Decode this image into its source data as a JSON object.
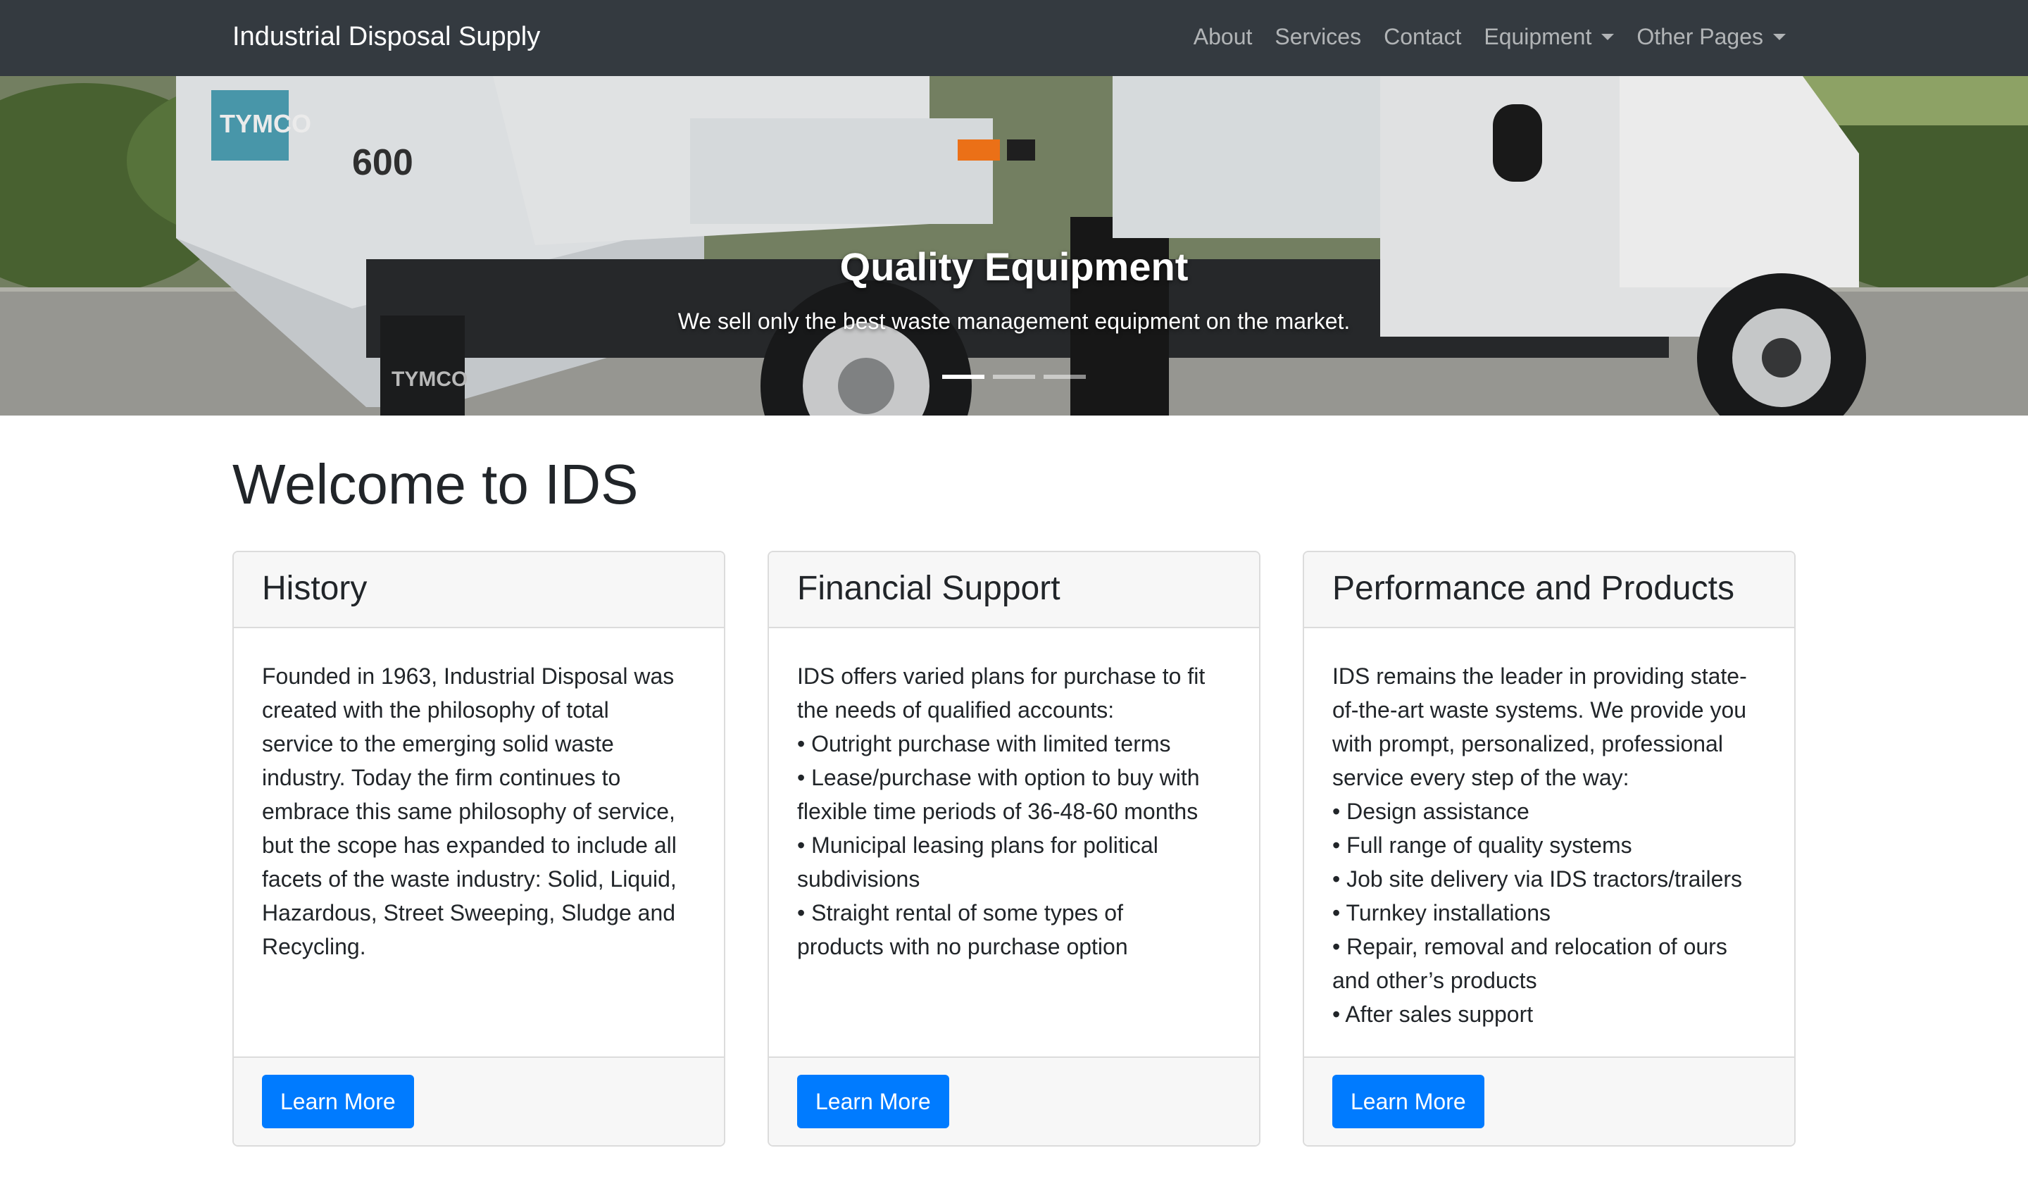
{
  "navbar": {
    "brand": "Industrial Disposal Supply",
    "links": [
      {
        "label": "About",
        "dropdown": false
      },
      {
        "label": "Services",
        "dropdown": false
      },
      {
        "label": "Contact",
        "dropdown": false
      },
      {
        "label": "Equipment",
        "dropdown": true
      },
      {
        "label": "Other Pages",
        "dropdown": true
      }
    ]
  },
  "hero": {
    "title": "Quality Equipment",
    "text": "We sell only the best waste management equipment on the market.",
    "slide_count": 3,
    "active_slide": 1,
    "truck_labels": [
      "TYMCO",
      "600",
      "TYMCO"
    ]
  },
  "main": {
    "title": "Welcome to IDS",
    "cards": [
      {
        "header": "History",
        "lines": [
          "Founded in 1963, Industrial Disposal was",
          "created with the philosophy of total",
          "service to the emerging solid waste",
          "industry. Today the firm continues to",
          "embrace this same philosophy of service,",
          "but the scope has expanded to include all",
          "facets of the waste industry: Solid, Liquid,",
          "Hazardous, Street Sweeping, Sludge and",
          "Recycling."
        ],
        "button": "Learn More"
      },
      {
        "header": "Financial Support",
        "lines": [
          "IDS offers varied plans for purchase to fit",
          "the needs of qualified accounts:",
          "• Outright purchase with limited terms",
          "• Lease/purchase with option to buy with",
          "flexible time periods of 36-48-60 months",
          "• Municipal leasing plans for political",
          "subdivisions",
          "• Straight rental of some types of",
          "products with no purchase option"
        ],
        "button": "Learn More"
      },
      {
        "header": "Performance and Products",
        "lines": [
          "IDS remains the leader in providing state-",
          "of-the-art waste systems. We provide you",
          "with prompt, personalized, professional",
          "service every step of the way:",
          "• Design assistance",
          "• Full range of quality systems",
          "• Job site delivery via IDS tractors/trailers",
          "• Turnkey installations",
          "• Repair, removal and relocation of ours",
          "and other’s products",
          "• After sales support"
        ],
        "button": "Learn More"
      }
    ]
  },
  "colors": {
    "navbar_bg": "#343a40",
    "primary": "#007bff",
    "card_header_bg": "#f7f7f7"
  }
}
